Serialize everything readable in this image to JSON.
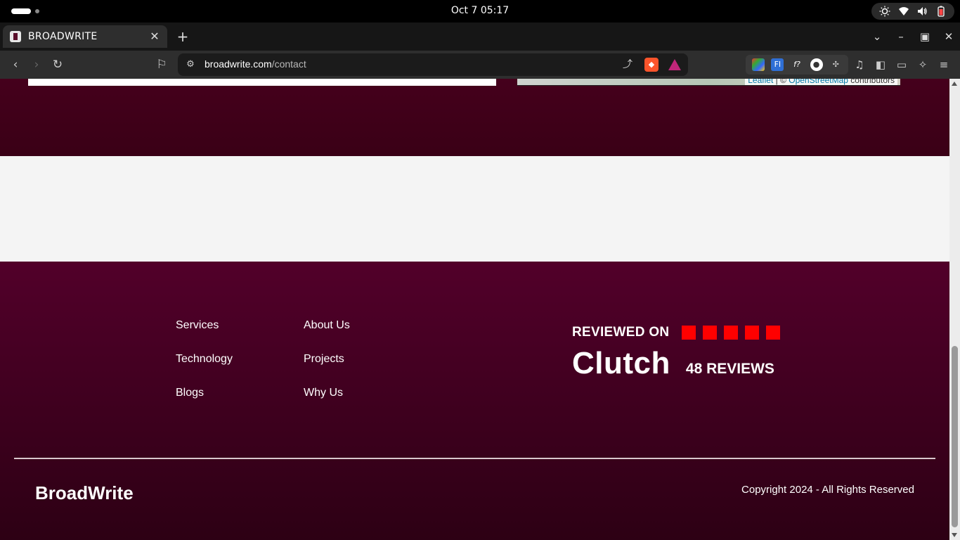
{
  "os": {
    "clock": "Oct 7  05:17"
  },
  "browser": {
    "tab_title": "BROADWRITE",
    "tab_close": "✕",
    "new_tab": "+",
    "url_domain": "broadwrite.com",
    "url_path": "/contact"
  },
  "map": {
    "attribution_leaflet": "Leaflet",
    "attribution_sep": " | © ",
    "attribution_osm": "OpenStreetMap",
    "attribution_suffix": " contributors"
  },
  "footer": {
    "links_col1": [
      "Services",
      "Technology",
      "Blogs"
    ],
    "links_col2": [
      "About Us",
      "Projects",
      "Why Us"
    ],
    "reviewed_on": "REVIEWED ON",
    "clutch_name": "Clutch",
    "review_count": "48 REVIEWS",
    "star_color": "#ff0000",
    "brand": "BroadWrite",
    "copyright": "Copyright 2024 - All Rights Reserved"
  },
  "colors": {
    "footer_top": "#52002a",
    "footer_bottom": "#2d0014",
    "contact_band": "#45001c"
  }
}
